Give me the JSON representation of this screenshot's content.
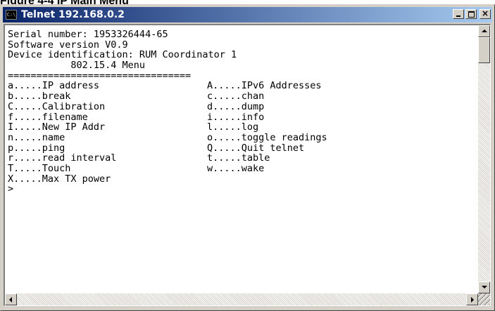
{
  "figure_caption": "Figure 4-4 IP Main Menu",
  "window": {
    "title": "Telnet 192.168.0.2",
    "icon": "console-icon",
    "icon_text": "C:\\"
  },
  "console": {
    "header_lines": [
      "Serial number: 1953326444-65",
      "Software version V0.9",
      "Device identification: RUM Coordinator 1",
      "           802.15.4 Menu",
      "================================"
    ],
    "menu_rows": [
      {
        "left": "a.....IP address",
        "right": "A.....IPv6 Addresses"
      },
      {
        "left": "b.....break",
        "right": "c.....chan"
      },
      {
        "left": "C.....Calibration",
        "right": "d.....dump"
      },
      {
        "left": "f.....filename",
        "right": "i.....info"
      },
      {
        "left": "I.....New IP Addr",
        "right": "l.....log"
      },
      {
        "left": "n.....name",
        "right": "o.....toggle readings"
      },
      {
        "left": "p.....ping",
        "right": "Q.....Quit telnet"
      },
      {
        "left": "r.....read interval",
        "right": "t.....table"
      },
      {
        "left": "T.....Touch",
        "right": "w.....wake"
      },
      {
        "left": "X.....Max TX power",
        "right": ""
      }
    ],
    "prompt": ">"
  },
  "colors": {
    "titlebar_start": "#0a246a",
    "titlebar_end": "#a6caf0",
    "window_face": "#d4d0c8",
    "console_bg": "#ffffff",
    "console_text": "#000000"
  }
}
